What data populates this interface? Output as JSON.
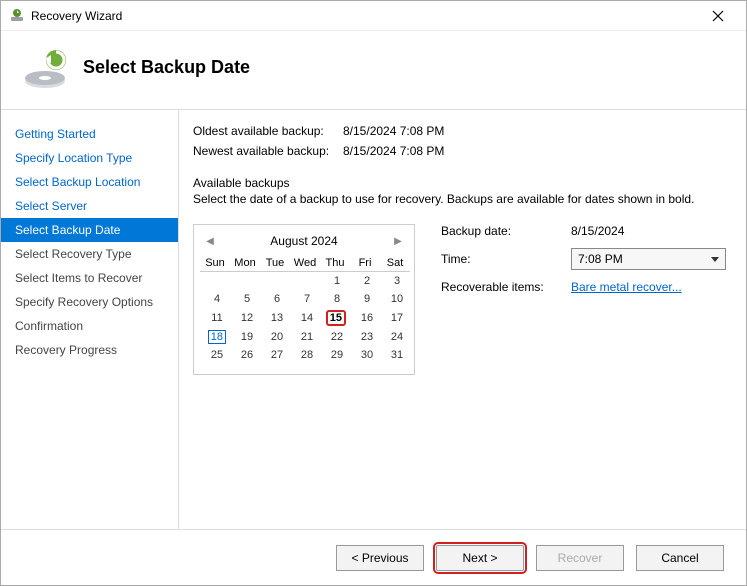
{
  "window": {
    "title": "Recovery Wizard"
  },
  "header": {
    "title": "Select Backup Date"
  },
  "sidebar": {
    "items": [
      {
        "label": "Getting Started"
      },
      {
        "label": "Specify Location Type"
      },
      {
        "label": "Select Backup Location"
      },
      {
        "label": "Select Server"
      },
      {
        "label": "Select Backup Date"
      },
      {
        "label": "Select Recovery Type"
      },
      {
        "label": "Select Items to Recover"
      },
      {
        "label": "Specify Recovery Options"
      },
      {
        "label": "Confirmation"
      },
      {
        "label": "Recovery Progress"
      }
    ]
  },
  "info": {
    "oldest_label": "Oldest available backup:",
    "oldest_value": "8/15/2024 7:08 PM",
    "newest_label": "Newest available backup:",
    "newest_value": "8/15/2024 7:08 PM"
  },
  "available": {
    "heading": "Available backups",
    "desc": "Select the date of a backup to use for recovery. Backups are available for dates shown in bold."
  },
  "calendar": {
    "month_label": "August 2024",
    "dow": [
      "Sun",
      "Mon",
      "Tue",
      "Wed",
      "Thu",
      "Fri",
      "Sat"
    ],
    "weeks": [
      [
        "",
        "",
        "",
        "",
        "1",
        "2",
        "3"
      ],
      [
        "4",
        "5",
        "6",
        "7",
        "8",
        "9",
        "10"
      ],
      [
        "11",
        "12",
        "13",
        "14",
        "15",
        "16",
        "17"
      ],
      [
        "18",
        "19",
        "20",
        "21",
        "22",
        "23",
        "24"
      ],
      [
        "25",
        "26",
        "27",
        "28",
        "29",
        "30",
        "31"
      ]
    ],
    "selected_day": "15",
    "today_day": "18"
  },
  "details": {
    "backup_date_label": "Backup date:",
    "backup_date_value": "8/15/2024",
    "time_label": "Time:",
    "time_value": "7:08 PM",
    "recoverable_label": "Recoverable items:",
    "recoverable_link": "Bare metal recover..."
  },
  "footer": {
    "previous": "< Previous",
    "next": "Next >",
    "recover": "Recover",
    "cancel": "Cancel"
  }
}
